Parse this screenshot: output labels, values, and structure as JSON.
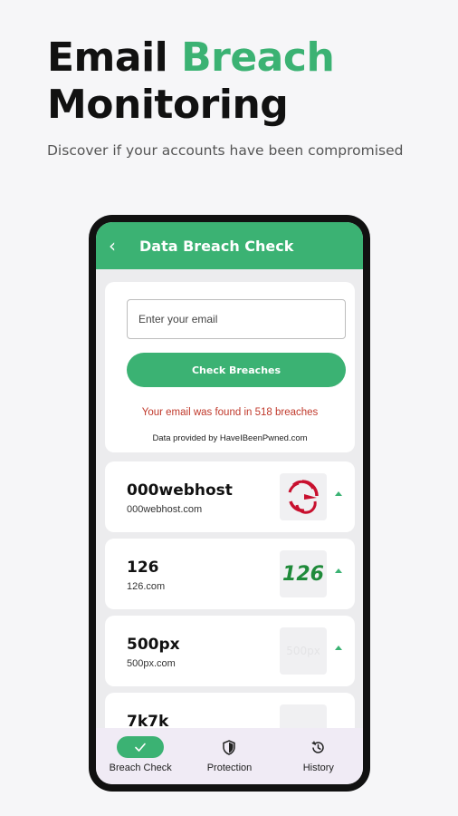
{
  "promo": {
    "title_part1": "Email",
    "title_part2": "Breach",
    "title_part3": "Monitoring",
    "subtitle": "Discover if your accounts have been compromised"
  },
  "appbar": {
    "title": "Data Breach Check",
    "back_icon": "chevron-left-icon"
  },
  "search": {
    "placeholder": "Enter your email",
    "value": "",
    "button_label": "Check Breaches",
    "result": "Your email was found in 518 breaches",
    "provider": "Data provided by HaveIBeenPwned.com"
  },
  "breaches": [
    {
      "name": "000webhost",
      "domain": "000webhost.com",
      "logo": "000webhost-logo"
    },
    {
      "name": "126",
      "domain": "126.com",
      "logo_text": "126",
      "logo": "126-logo"
    },
    {
      "name": "500px",
      "domain": "500px.com",
      "logo_text": "500px",
      "logo": "500px-logo"
    },
    {
      "name": "7k7k",
      "domain": "",
      "logo": "7k7k-logo"
    }
  ],
  "nav": [
    {
      "label": "Breach Check",
      "icon": "check-icon",
      "active": true
    },
    {
      "label": "Protection",
      "icon": "shield-icon",
      "active": false
    },
    {
      "label": "History",
      "icon": "history-icon",
      "active": false
    }
  ],
  "colors": {
    "accent": "#3bb273",
    "alert": "#c0392b",
    "nav_bg": "#f0ebf5"
  }
}
